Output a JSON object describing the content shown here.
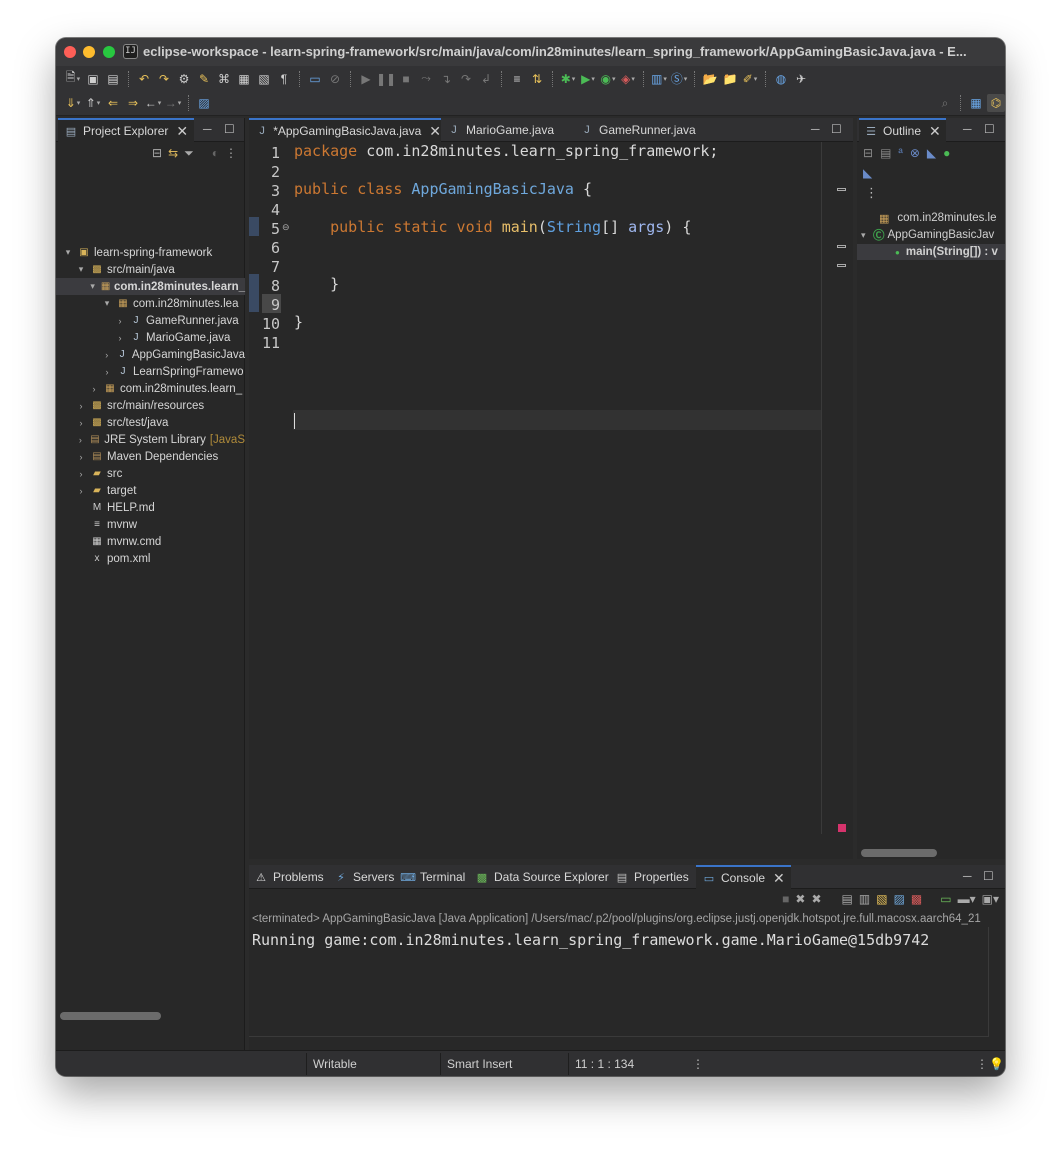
{
  "window": {
    "title": "eclipse-workspace - learn-spring-framework/src/main/java/com/in28minutes/learn_spring_framework/AppGamingBasicJava.java - E...",
    "app_icon": "eclipse-icon"
  },
  "explorer": {
    "tab_label": "Project Explorer",
    "tree": [
      {
        "label": "learn-spring-framework",
        "indent": 0,
        "arrow": "▾",
        "icon": "project-icon"
      },
      {
        "label": "src/main/java",
        "indent": 1,
        "arrow": "▾",
        "icon": "source-folder-icon"
      },
      {
        "label": "com.in28minutes.learn_",
        "indent": 2,
        "arrow": "▾",
        "icon": "package-icon",
        "selected": true
      },
      {
        "label": "com.in28minutes.lea",
        "indent": 3,
        "arrow": "▾",
        "icon": "package-icon"
      },
      {
        "label": "GameRunner.java",
        "indent": 4,
        "arrow": "›",
        "icon": "java-file-icon"
      },
      {
        "label": "MarioGame.java",
        "indent": 4,
        "arrow": "›",
        "icon": "java-file-icon"
      },
      {
        "label": "AppGamingBasicJava",
        "indent": 3,
        "arrow": "›",
        "icon": "java-file-icon"
      },
      {
        "label": "LearnSpringFramewo",
        "indent": 3,
        "arrow": "›",
        "icon": "java-file-icon"
      },
      {
        "label": "com.in28minutes.learn_",
        "indent": 2,
        "arrow": "›",
        "icon": "package-icon"
      },
      {
        "label": "src/main/resources",
        "indent": 1,
        "arrow": "›",
        "icon": "source-folder-icon"
      },
      {
        "label": "src/test/java",
        "indent": 1,
        "arrow": "›",
        "icon": "source-folder-icon"
      },
      {
        "label": "JRE System Library",
        "suffix": "[JavaS",
        "indent": 1,
        "arrow": "›",
        "icon": "library-icon"
      },
      {
        "label": "Maven Dependencies",
        "indent": 1,
        "arrow": "›",
        "icon": "library-icon"
      },
      {
        "label": "src",
        "indent": 1,
        "arrow": "›",
        "icon": "folder-icon"
      },
      {
        "label": "target",
        "indent": 1,
        "arrow": "›",
        "icon": "folder-icon"
      },
      {
        "label": "HELP.md",
        "indent": 1,
        "arrow": "",
        "icon": "markdown-file-icon"
      },
      {
        "label": "mvnw",
        "indent": 1,
        "arrow": "",
        "icon": "text-file-icon"
      },
      {
        "label": "mvnw.cmd",
        "indent": 1,
        "arrow": "",
        "icon": "cmd-file-icon"
      },
      {
        "label": "pom.xml",
        "indent": 1,
        "arrow": "",
        "icon": "xml-file-icon"
      }
    ]
  },
  "editor": {
    "tabs": [
      {
        "label": "*AppGamingBasicJava.java",
        "active": true
      },
      {
        "label": "MarioGame.java",
        "active": false
      },
      {
        "label": "GameRunner.java",
        "active": false
      }
    ],
    "line_numbers": [
      "1",
      "2",
      "3",
      "4",
      "5",
      "6",
      "7",
      "8",
      "9",
      "10",
      "11"
    ],
    "code": {
      "line1_kw": "package",
      "line1_rest": " com.in28minutes.learn_spring_framework;",
      "line3_kw": "public class",
      "line3_cls": "AppGamingBasicJava",
      "line3_rest": " {",
      "line5_kw": "public static void",
      "line5_fn": "main",
      "line5_open": "(",
      "line5_type": "String",
      "line5_arr": "[] ",
      "line5_param": "args",
      "line5_rest": ") {",
      "line8": "}",
      "line10": "}"
    }
  },
  "outline": {
    "tab_label": "Outline",
    "items": [
      {
        "label": "com.in28minutes.le",
        "icon": "package-icon"
      },
      {
        "label": "AppGamingBasicJav",
        "icon": "class-icon"
      },
      {
        "label": "main(String[]) : v",
        "icon": "method-icon"
      }
    ]
  },
  "console": {
    "tabs": [
      "Problems",
      "Servers",
      "Terminal",
      "Data Source Explorer",
      "Properties",
      "Console"
    ],
    "active_tab": "Console",
    "status": "<terminated> AppGamingBasicJava [Java Application] /Users/mac/.p2/pool/plugins/org.eclipse.justj.openjdk.hotspot.jre.full.macosx.aarch64_21",
    "output": "Running game:com.in28minutes.learn_spring_framework.game.MarioGame@15db9742"
  },
  "statusbar": {
    "mode": "Writable",
    "insert": "Smart Insert",
    "position": "11 : 1 : 134"
  }
}
